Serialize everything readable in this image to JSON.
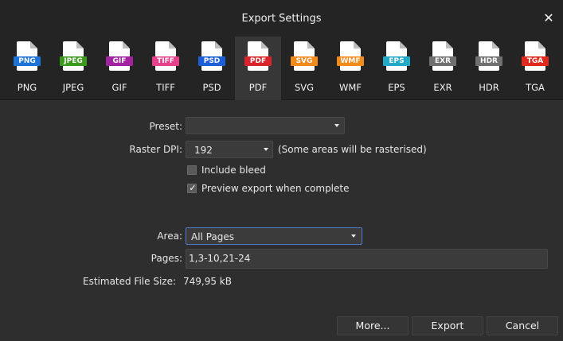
{
  "window": {
    "title": "Export Settings",
    "close_glyph": "✕"
  },
  "formats": [
    {
      "label": "PNG",
      "badge": "PNG",
      "color": "#1e73d8",
      "selected": false
    },
    {
      "label": "JPEG",
      "badge": "JPEG",
      "color": "#3b9a1e",
      "selected": false
    },
    {
      "label": "GIF",
      "badge": "GIF",
      "color": "#a1239f",
      "selected": false
    },
    {
      "label": "TIFF",
      "badge": "TIFF",
      "color": "#e7418d",
      "selected": false
    },
    {
      "label": "PSD",
      "badge": "PSD",
      "color": "#1d5fd6",
      "selected": false
    },
    {
      "label": "PDF",
      "badge": "PDF",
      "color": "#d9242b",
      "selected": true
    },
    {
      "label": "SVG",
      "badge": "SVG",
      "color": "#f28a1c",
      "selected": false
    },
    {
      "label": "WMF",
      "badge": "WMF",
      "color": "#f28a1c",
      "selected": false
    },
    {
      "label": "EPS",
      "badge": "EPS",
      "color": "#22a9c7",
      "selected": false
    },
    {
      "label": "EXR",
      "badge": "EXR",
      "color": "#707070",
      "selected": false
    },
    {
      "label": "HDR",
      "badge": "HDR",
      "color": "#707070",
      "selected": false
    },
    {
      "label": "TGA",
      "badge": "TGA",
      "color": "#e02a1e",
      "selected": false
    }
  ],
  "settings": {
    "preset_label": "Preset:",
    "preset_value": "",
    "raster_dpi_label": "Raster DPI:",
    "raster_dpi_value": "192",
    "raster_note": "(Some areas will be rasterised)",
    "include_bleed_label": "Include bleed",
    "include_bleed_checked": false,
    "preview_label": "Preview export when complete",
    "preview_checked": true,
    "check_glyph": "✓",
    "area_label": "Area:",
    "area_value": "All Pages",
    "pages_label": "Pages:",
    "pages_value": "1,3-10,21-24",
    "estimated_label": "Estimated File Size:",
    "estimated_value": "749,95 kB"
  },
  "buttons": {
    "more": "More...",
    "export": "Export",
    "cancel": "Cancel"
  }
}
